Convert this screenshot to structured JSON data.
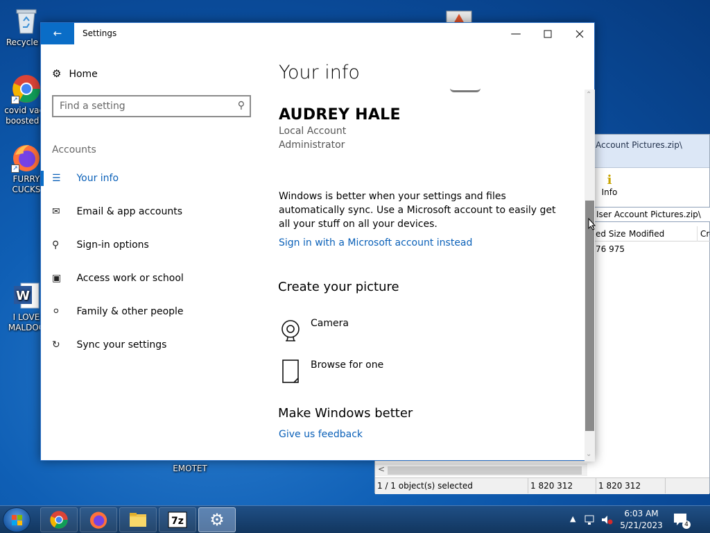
{
  "desktop": {
    "icons": [
      {
        "label": "Recycle B",
        "icon": "recycle-bin-icon"
      },
      {
        "label": "covid vacc boosted h",
        "icon": "chrome-icon"
      },
      {
        "label": "FURRY CUCKS",
        "icon": "firefox-icon"
      },
      {
        "label": "I LOVE MALDOC",
        "icon": "word-icon"
      },
      {
        "label": "EMOTET",
        "icon": "file-icon"
      }
    ]
  },
  "zip_window": {
    "title": "Account Pictures.zip\\",
    "info_button": "Info",
    "path": "Iser Account Pictures.zip\\",
    "columns": [
      "ed Size",
      "Modified",
      "Cre"
    ],
    "cell_value": "76 975",
    "status": {
      "selected": "1 / 1 object(s) selected",
      "size1": "1 820 312",
      "size2": "1 820 312"
    }
  },
  "settings": {
    "window_title": "Settings",
    "nav": {
      "home": "Home",
      "search_placeholder": "Find a setting",
      "section": "Accounts",
      "items": [
        {
          "label": "Your info",
          "icon": "person-card-icon",
          "active": true
        },
        {
          "label": "Email & app accounts",
          "icon": "mail-icon",
          "active": false
        },
        {
          "label": "Sign-in options",
          "icon": "key-icon",
          "active": false
        },
        {
          "label": "Access work or school",
          "icon": "briefcase-icon",
          "active": false
        },
        {
          "label": "Family & other people",
          "icon": "person-add-icon",
          "active": false
        },
        {
          "label": "Sync your settings",
          "icon": "sync-icon",
          "active": false
        }
      ]
    },
    "main": {
      "title": "Your info",
      "user_name": "AUDREY HALE",
      "account_type": "Local Account",
      "role": "Administrator",
      "info_text": "Windows is better when your settings and files automatically sync. Use a Microsoft account to easily get all your stuff on all your devices.",
      "ms_link": "Sign in with a Microsoft account instead",
      "create_picture_heading": "Create your picture",
      "camera_label": "Camera",
      "browse_label": "Browse for one",
      "make_better_heading": "Make Windows better",
      "feedback_link": "Give us feedback"
    }
  },
  "taskbar": {
    "time": "6:03 AM",
    "date": "5/21/2023",
    "notification_count": "4",
    "apps": [
      "chrome",
      "firefox",
      "file-explorer",
      "7-zip",
      "settings"
    ]
  },
  "colors": {
    "accent": "#0a6dc7",
    "link": "#0a60b8"
  }
}
